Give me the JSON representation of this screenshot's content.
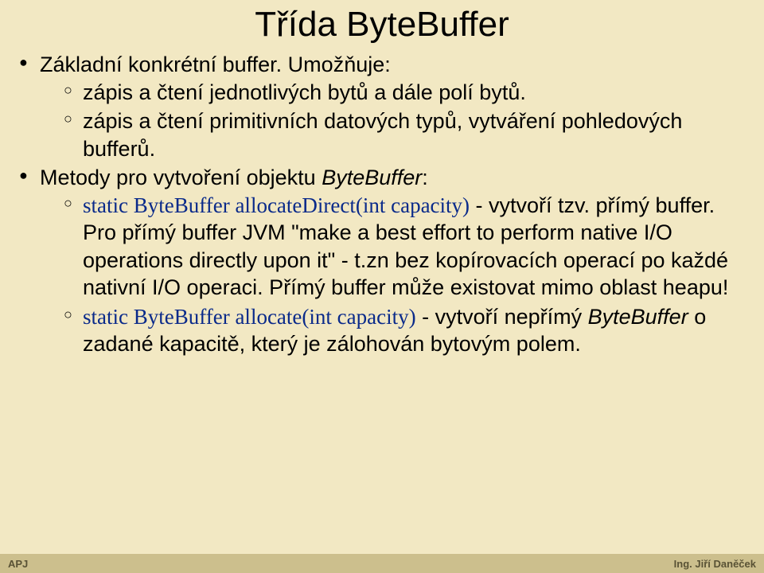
{
  "title": "Třída ByteBuffer",
  "bullets": {
    "b1": "Základní konkrétní buffer. Umožňuje:",
    "b1_1": "zápis a čtení jednotlivých bytů a dále polí bytů.",
    "b1_2": "zápis a čtení primitivních datových typů, vytváření pohledových bufferů.",
    "b2_pre": "Metody pro vytvoření objektu ",
    "b2_em": "ByteBuffer",
    "b2_post": ":",
    "b2_1_link": "static ByteBuffer allocateDirect(int capacity)",
    "b2_1_rest": " - vytvoří tzv. přímý buffer. Pro přímý buffer JVM \"make a best effort to perform native I/O operations directly upon it\" - t.zn bez kopírovacích operací po každé nativní I/O operaci. Přímý buffer může existovat mimo oblast heapu!",
    "b2_2_link": "static ByteBuffer allocate(int capacity)",
    "b2_2_mid": " - vytvoří nepřímý ",
    "b2_2_em": "ByteBuffer",
    "b2_2_tail": " o zadané kapacitě, který je zálohován bytovým polem."
  },
  "footer": {
    "left": "APJ",
    "right": "Ing. Jiří Daněček"
  }
}
